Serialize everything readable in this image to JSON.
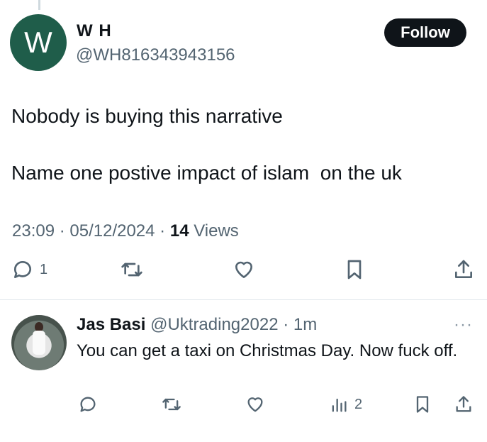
{
  "tweet": {
    "avatar_letter": "W",
    "display_name": "W H",
    "handle": "@WH816343943156",
    "follow_label": "Follow",
    "text_line1": "Nobody is buying this narrative",
    "text_line2": "Name one postive impact of islam  on the uk",
    "timestamp": "23:09 · 05/12/2024 · ",
    "views_count": "14",
    "views_label": " Views",
    "reply_count": "1"
  },
  "reply": {
    "display_name": "Jas Basi",
    "handle": "@Uktrading2022",
    "time": " · 1m",
    "more": "···",
    "text": "You can get a taxi on Christmas Day. Now fuck off.",
    "views_count": "2"
  },
  "colors": {
    "avatar_bg": "#1f5d4a",
    "follow_bg": "#0f1419",
    "secondary_text": "#536471"
  }
}
